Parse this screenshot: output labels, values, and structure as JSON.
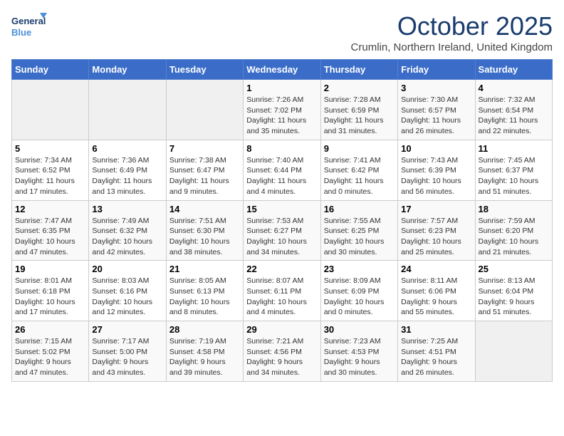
{
  "header": {
    "logo_line1": "General",
    "logo_line2": "Blue",
    "month": "October 2025",
    "location": "Crumlin, Northern Ireland, United Kingdom"
  },
  "days_of_week": [
    "Sunday",
    "Monday",
    "Tuesday",
    "Wednesday",
    "Thursday",
    "Friday",
    "Saturday"
  ],
  "weeks": [
    [
      {
        "num": "",
        "info": ""
      },
      {
        "num": "",
        "info": ""
      },
      {
        "num": "",
        "info": ""
      },
      {
        "num": "1",
        "info": "Sunrise: 7:26 AM\nSunset: 7:02 PM\nDaylight: 11 hours\nand 35 minutes."
      },
      {
        "num": "2",
        "info": "Sunrise: 7:28 AM\nSunset: 6:59 PM\nDaylight: 11 hours\nand 31 minutes."
      },
      {
        "num": "3",
        "info": "Sunrise: 7:30 AM\nSunset: 6:57 PM\nDaylight: 11 hours\nand 26 minutes."
      },
      {
        "num": "4",
        "info": "Sunrise: 7:32 AM\nSunset: 6:54 PM\nDaylight: 11 hours\nand 22 minutes."
      }
    ],
    [
      {
        "num": "5",
        "info": "Sunrise: 7:34 AM\nSunset: 6:52 PM\nDaylight: 11 hours\nand 17 minutes."
      },
      {
        "num": "6",
        "info": "Sunrise: 7:36 AM\nSunset: 6:49 PM\nDaylight: 11 hours\nand 13 minutes."
      },
      {
        "num": "7",
        "info": "Sunrise: 7:38 AM\nSunset: 6:47 PM\nDaylight: 11 hours\nand 9 minutes."
      },
      {
        "num": "8",
        "info": "Sunrise: 7:40 AM\nSunset: 6:44 PM\nDaylight: 11 hours\nand 4 minutes."
      },
      {
        "num": "9",
        "info": "Sunrise: 7:41 AM\nSunset: 6:42 PM\nDaylight: 11 hours\nand 0 minutes."
      },
      {
        "num": "10",
        "info": "Sunrise: 7:43 AM\nSunset: 6:39 PM\nDaylight: 10 hours\nand 56 minutes."
      },
      {
        "num": "11",
        "info": "Sunrise: 7:45 AM\nSunset: 6:37 PM\nDaylight: 10 hours\nand 51 minutes."
      }
    ],
    [
      {
        "num": "12",
        "info": "Sunrise: 7:47 AM\nSunset: 6:35 PM\nDaylight: 10 hours\nand 47 minutes."
      },
      {
        "num": "13",
        "info": "Sunrise: 7:49 AM\nSunset: 6:32 PM\nDaylight: 10 hours\nand 42 minutes."
      },
      {
        "num": "14",
        "info": "Sunrise: 7:51 AM\nSunset: 6:30 PM\nDaylight: 10 hours\nand 38 minutes."
      },
      {
        "num": "15",
        "info": "Sunrise: 7:53 AM\nSunset: 6:27 PM\nDaylight: 10 hours\nand 34 minutes."
      },
      {
        "num": "16",
        "info": "Sunrise: 7:55 AM\nSunset: 6:25 PM\nDaylight: 10 hours\nand 30 minutes."
      },
      {
        "num": "17",
        "info": "Sunrise: 7:57 AM\nSunset: 6:23 PM\nDaylight: 10 hours\nand 25 minutes."
      },
      {
        "num": "18",
        "info": "Sunrise: 7:59 AM\nSunset: 6:20 PM\nDaylight: 10 hours\nand 21 minutes."
      }
    ],
    [
      {
        "num": "19",
        "info": "Sunrise: 8:01 AM\nSunset: 6:18 PM\nDaylight: 10 hours\nand 17 minutes."
      },
      {
        "num": "20",
        "info": "Sunrise: 8:03 AM\nSunset: 6:16 PM\nDaylight: 10 hours\nand 12 minutes."
      },
      {
        "num": "21",
        "info": "Sunrise: 8:05 AM\nSunset: 6:13 PM\nDaylight: 10 hours\nand 8 minutes."
      },
      {
        "num": "22",
        "info": "Sunrise: 8:07 AM\nSunset: 6:11 PM\nDaylight: 10 hours\nand 4 minutes."
      },
      {
        "num": "23",
        "info": "Sunrise: 8:09 AM\nSunset: 6:09 PM\nDaylight: 10 hours\nand 0 minutes."
      },
      {
        "num": "24",
        "info": "Sunrise: 8:11 AM\nSunset: 6:06 PM\nDaylight: 9 hours\nand 55 minutes."
      },
      {
        "num": "25",
        "info": "Sunrise: 8:13 AM\nSunset: 6:04 PM\nDaylight: 9 hours\nand 51 minutes."
      }
    ],
    [
      {
        "num": "26",
        "info": "Sunrise: 7:15 AM\nSunset: 5:02 PM\nDaylight: 9 hours\nand 47 minutes."
      },
      {
        "num": "27",
        "info": "Sunrise: 7:17 AM\nSunset: 5:00 PM\nDaylight: 9 hours\nand 43 minutes."
      },
      {
        "num": "28",
        "info": "Sunrise: 7:19 AM\nSunset: 4:58 PM\nDaylight: 9 hours\nand 39 minutes."
      },
      {
        "num": "29",
        "info": "Sunrise: 7:21 AM\nSunset: 4:56 PM\nDaylight: 9 hours\nand 34 minutes."
      },
      {
        "num": "30",
        "info": "Sunrise: 7:23 AM\nSunset: 4:53 PM\nDaylight: 9 hours\nand 30 minutes."
      },
      {
        "num": "31",
        "info": "Sunrise: 7:25 AM\nSunset: 4:51 PM\nDaylight: 9 hours\nand 26 minutes."
      },
      {
        "num": "",
        "info": ""
      }
    ]
  ]
}
